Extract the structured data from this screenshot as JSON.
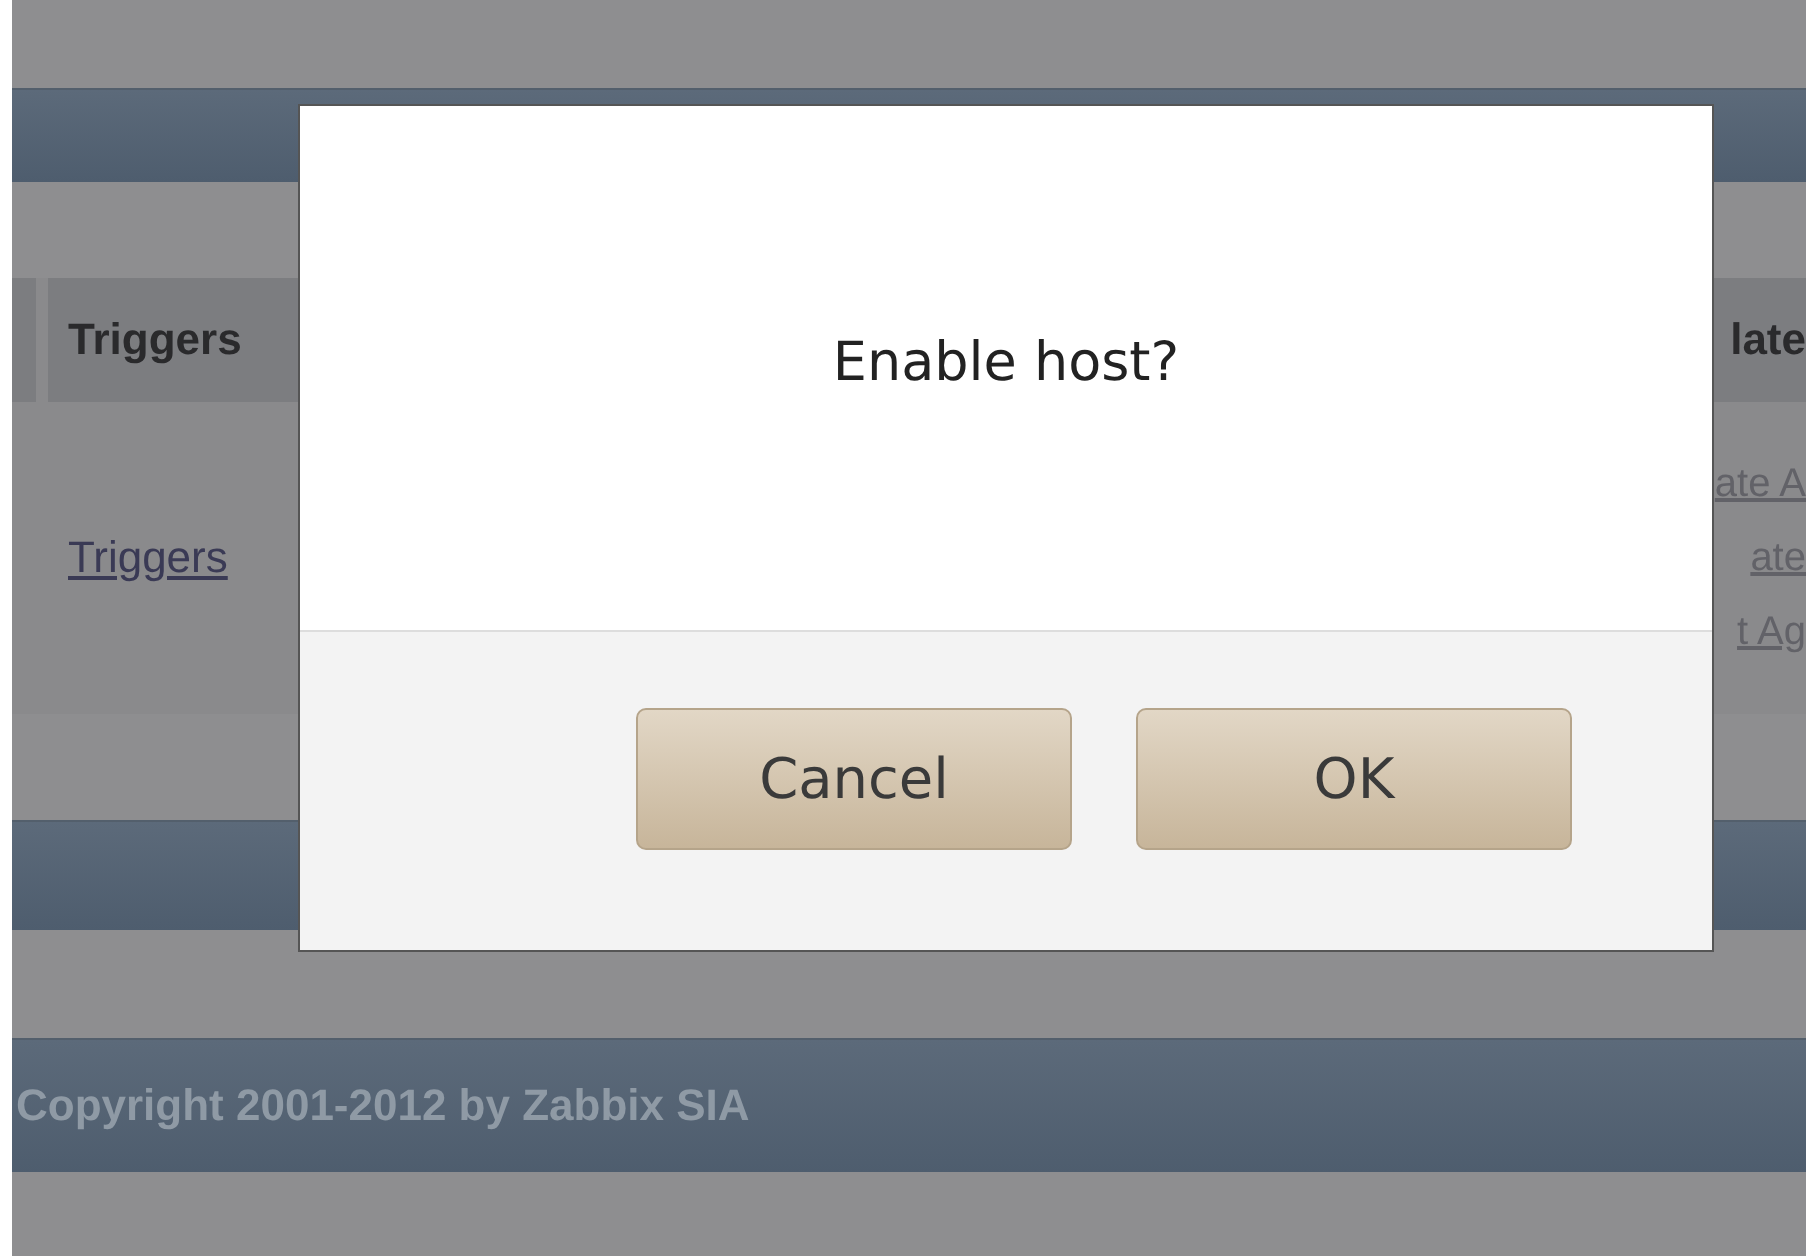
{
  "table": {
    "columns": [
      {
        "label": "Triggers"
      },
      {
        "label": "late"
      }
    ],
    "triggers_link": "Triggers",
    "right_links": [
      "ate A",
      "ate",
      "t Ag"
    ]
  },
  "footer": {
    "copyright": "Copyright 2001-2012 by Zabbix SIA"
  },
  "dialog": {
    "message": "Enable host?",
    "buttons": [
      {
        "label": "Cancel"
      },
      {
        "label": "OK"
      }
    ]
  }
}
